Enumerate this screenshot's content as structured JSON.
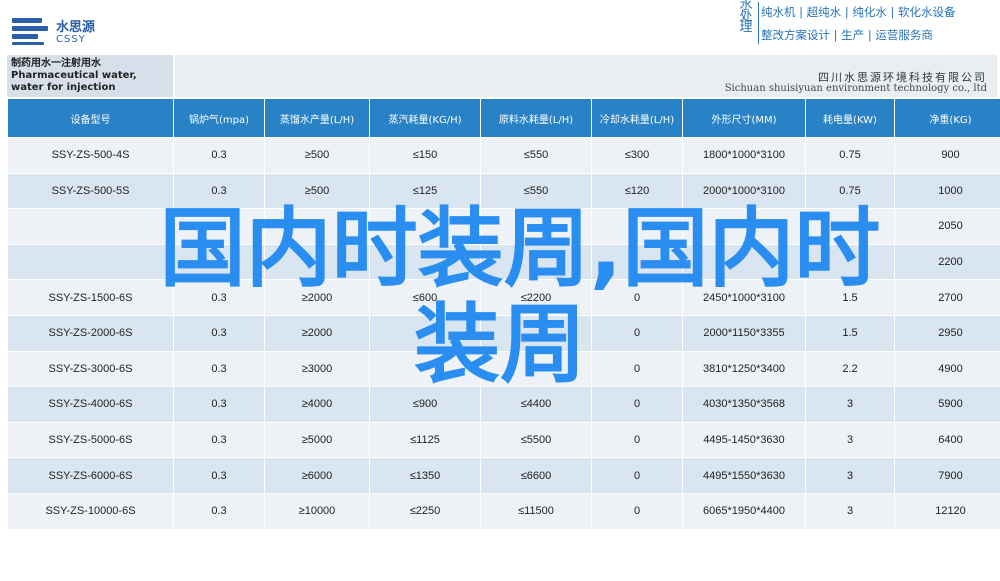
{
  "header": {
    "logo": {
      "name": "水思源",
      "sub": "CSSY",
      "icon": "logo-stripes-icon"
    },
    "brand": {
      "vertical": [
        "水",
        "处",
        "理"
      ],
      "line1": "纯水机 | 超纯水 | 纯化水 | 软化水设备",
      "line2": "整改方案设计 | 生产 | 运营服务商"
    }
  },
  "title_band": {
    "left": "制药用水一注射用水 Pharmaceutical water, water for injection",
    "company_cn": "四川水思源环境科技有限公司",
    "company_en": "Sichuan shuisiyuan environment technology co., ltd"
  },
  "table": {
    "headers": [
      "设备型号",
      "锅炉气(mpa)",
      "蒸馏水产量(L/H)",
      "蒸汽耗量(KG/H)",
      "原料水耗量(L/H)",
      "冷却水耗量(L/H)",
      "外形尺寸(MM)",
      "耗电量(KW)",
      "净重(KG)"
    ],
    "rows": [
      [
        "SSY-ZS-500-4S",
        "0.3",
        "≥500",
        "≤150",
        "≤550",
        "≤300",
        "1800*1000*3100",
        "0.75",
        "900"
      ],
      [
        "SSY-ZS-500-5S",
        "0.3",
        "≥500",
        "≤125",
        "≤550",
        "≤120",
        "2000*1000*3100",
        "0.75",
        "1000"
      ],
      [
        "",
        "",
        "",
        "",
        "",
        "",
        "",
        "",
        "2050"
      ],
      [
        "",
        "",
        "",
        "",
        "",
        "",
        "",
        "",
        "2200"
      ],
      [
        "SSY-ZS-1500-6S",
        "0.3",
        "≥2000",
        "≤600",
        "≤2200",
        "0",
        "2450*1000*3100",
        "1.5",
        "2700"
      ],
      [
        "SSY-ZS-2000-6S",
        "0.3",
        "≥2000",
        "",
        "",
        "0",
        "2000*1150*3355",
        "1.5",
        "2950"
      ],
      [
        "SSY-ZS-3000-6S",
        "0.3",
        "≥3000",
        "",
        "",
        "0",
        "3810*1250*3400",
        "2.2",
        "4900"
      ],
      [
        "SSY-ZS-4000-6S",
        "0.3",
        "≥4000",
        "≤900",
        "≤4400",
        "0",
        "4030*1350*3568",
        "3",
        "5900"
      ],
      [
        "SSY-ZS-5000-6S",
        "0.3",
        "≥5000",
        "≤1125",
        "≤5500",
        "0",
        "4495-1450*3630",
        "3",
        "6400"
      ],
      [
        "SSY-ZS-6000-6S",
        "0.3",
        "≥6000",
        "≤1350",
        "≤6600",
        "0",
        "4495*1550*3630",
        "3",
        "7900"
      ],
      [
        "SSY-ZS-10000-6S",
        "0.3",
        "≥10000",
        "≤2250",
        "≤11500",
        "0",
        "6065*1950*4400",
        "3",
        "12120"
      ]
    ]
  },
  "overlay": {
    "line1": "国内时装周,国内时",
    "line2": "装周"
  }
}
